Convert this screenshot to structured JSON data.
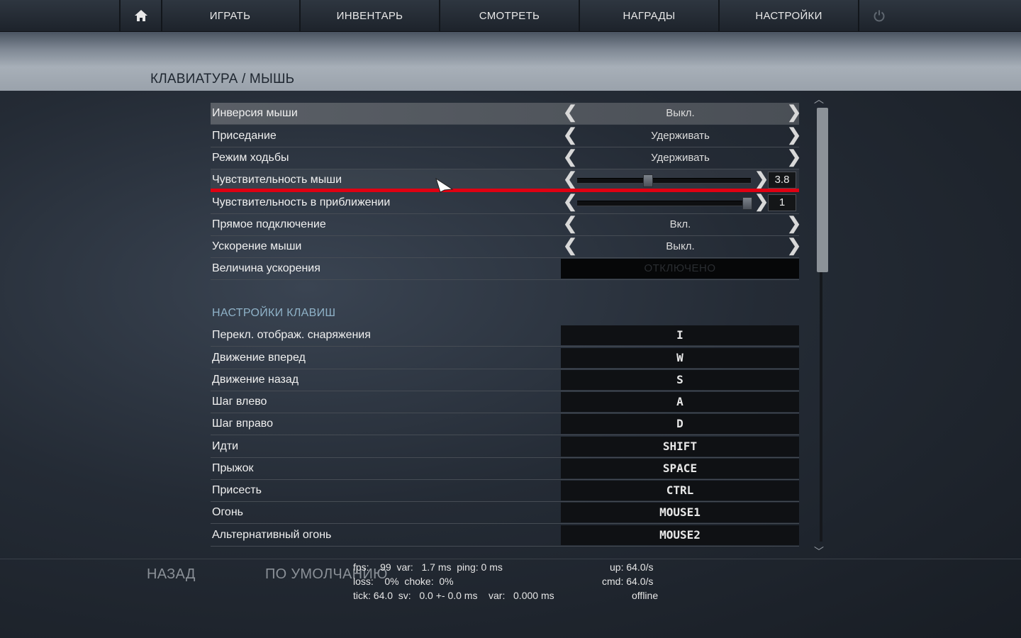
{
  "nav": {
    "items": [
      "ИГРАТЬ",
      "ИНВЕНТАРЬ",
      "СМОТРЕТЬ",
      "НАГРАДЫ",
      "НАСТРОЙКИ"
    ],
    "home_icon": "home-icon",
    "power_icon": "power-icon"
  },
  "page": {
    "title": "КЛАВИАТУРА / МЫШЬ"
  },
  "mouse_settings": [
    {
      "label": "Инверсия мыши",
      "value": "Выкл."
    },
    {
      "label": "Приседание",
      "value": "Удерживать"
    },
    {
      "label": "Режим ходьбы",
      "value": "Удерживать"
    },
    {
      "label": "Чувствительность мыши",
      "value": "3.8",
      "slider_fraction": 0.4
    },
    {
      "label": "Чувствительность в приближении",
      "value": "1",
      "slider_fraction": 1.0
    },
    {
      "label": "Прямое подключение",
      "value": "Вкл."
    },
    {
      "label": "Ускорение мыши",
      "value": "Выкл."
    },
    {
      "label": "Величина ускорения",
      "value": "ОТКЛЮЧЕНО"
    }
  ],
  "keys_section": {
    "title": "НАСТРОЙКИ КЛАВИШ",
    "bindings": [
      {
        "label": "Перекл. отображ. снаряжения",
        "key": "I"
      },
      {
        "label": "Движение вперед",
        "key": "W"
      },
      {
        "label": "Движение назад",
        "key": "S"
      },
      {
        "label": "Шаг влево",
        "key": "A"
      },
      {
        "label": "Шаг вправо",
        "key": "D"
      },
      {
        "label": "Идти",
        "key": "SHIFT"
      },
      {
        "label": "Прыжок",
        "key": "SPACE"
      },
      {
        "label": "Присесть",
        "key": "CTRL"
      },
      {
        "label": "Огонь",
        "key": "MOUSE1"
      },
      {
        "label": "Альтернативный огонь",
        "key": "MOUSE2"
      }
    ]
  },
  "footer": {
    "back": "НАЗАД",
    "defaults": "ПО УМОЛЧАНИЮ"
  },
  "netgraph": {
    "line1": "fps:    99  var:   1.7 ms  ping: 0 ms",
    "line2": "loss:    0%  choke:  0%",
    "line3": "tick: 64.0  sv:   0.0 +- 0.0 ms    var:   0.000 ms",
    "up": "up: 64.0/s",
    "cmd": "cmd: 64.0/s",
    "status": "offline"
  },
  "colors": {
    "highlight_red": "#e00012",
    "section_blue": "#8fb2c8"
  }
}
